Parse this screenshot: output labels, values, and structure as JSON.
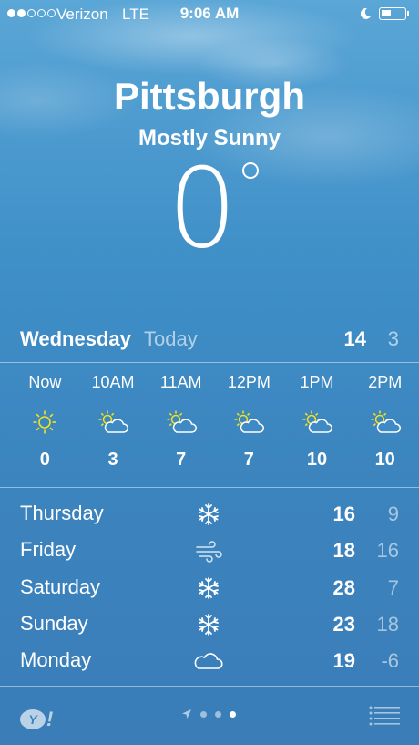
{
  "status_bar": {
    "signal_filled": 2,
    "signal_total": 5,
    "carrier": "Verizon",
    "network": "LTE",
    "time": "9:06 AM",
    "battery_level": 0.45
  },
  "header": {
    "city": "Pittsburgh",
    "condition": "Mostly Sunny",
    "temperature": "0"
  },
  "today": {
    "day": "Wednesday",
    "label": "Today",
    "high": "14",
    "low": "3"
  },
  "hourly": [
    {
      "time": "Now",
      "icon": "sun-icon",
      "temp": "0"
    },
    {
      "time": "10AM",
      "icon": "partly-cloudy-icon",
      "temp": "3"
    },
    {
      "time": "11AM",
      "icon": "partly-cloudy-icon",
      "temp": "7"
    },
    {
      "time": "12PM",
      "icon": "partly-cloudy-icon",
      "temp": "7"
    },
    {
      "time": "1PM",
      "icon": "partly-cloudy-icon",
      "temp": "10"
    },
    {
      "time": "2PM",
      "icon": "partly-cloudy-icon",
      "temp": "10"
    }
  ],
  "daily": [
    {
      "day": "Thursday",
      "icon": "snowflake-icon",
      "high": "16",
      "low": "9"
    },
    {
      "day": "Friday",
      "icon": "wind-icon",
      "high": "18",
      "low": "16"
    },
    {
      "day": "Saturday",
      "icon": "snowflake-icon",
      "high": "28",
      "low": "7"
    },
    {
      "day": "Sunday",
      "icon": "snowflake-icon",
      "high": "23",
      "low": "18"
    },
    {
      "day": "Monday",
      "icon": "cloud-icon",
      "high": "19",
      "low": "-6"
    }
  ],
  "footer": {
    "logo_letter": "Y",
    "logo_mark": "!",
    "pages": 3,
    "active_page": 3
  }
}
